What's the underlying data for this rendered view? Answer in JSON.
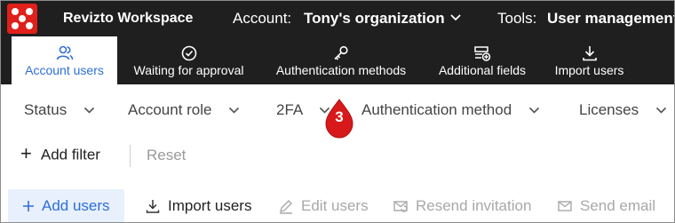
{
  "app": {
    "brand": "Revizto Workspace",
    "account_label": "Account:",
    "account_value": "Tony's organization",
    "tools_label": "Tools:",
    "tools_value": "User management"
  },
  "tabs": [
    {
      "label": "Account users",
      "icon": "users-icon",
      "active": true
    },
    {
      "label": "Waiting for approval",
      "icon": "check-circle-icon",
      "active": false
    },
    {
      "label": "Authentication methods",
      "icon": "key-icon",
      "active": false
    },
    {
      "label": "Additional fields",
      "icon": "add-field-icon",
      "active": false
    },
    {
      "label": "Import users",
      "icon": "download-icon",
      "active": false
    }
  ],
  "filters": [
    "Status",
    "Account role",
    "2FA",
    "Authentication method",
    "Licenses"
  ],
  "filter_actions": {
    "add_filter": "Add filter",
    "reset": "Reset"
  },
  "actions": {
    "add_users": "Add users",
    "import_users": "Import users",
    "edit_users": "Edit users",
    "resend_invitation": "Resend invitation",
    "send_email": "Send email"
  },
  "marker": {
    "number": "3",
    "color": "#d7191c"
  },
  "colors": {
    "topbar": "#1f1f1f",
    "accent": "#2e6fd6",
    "brand": "#e0201a",
    "disabled": "#a8a8a8"
  }
}
